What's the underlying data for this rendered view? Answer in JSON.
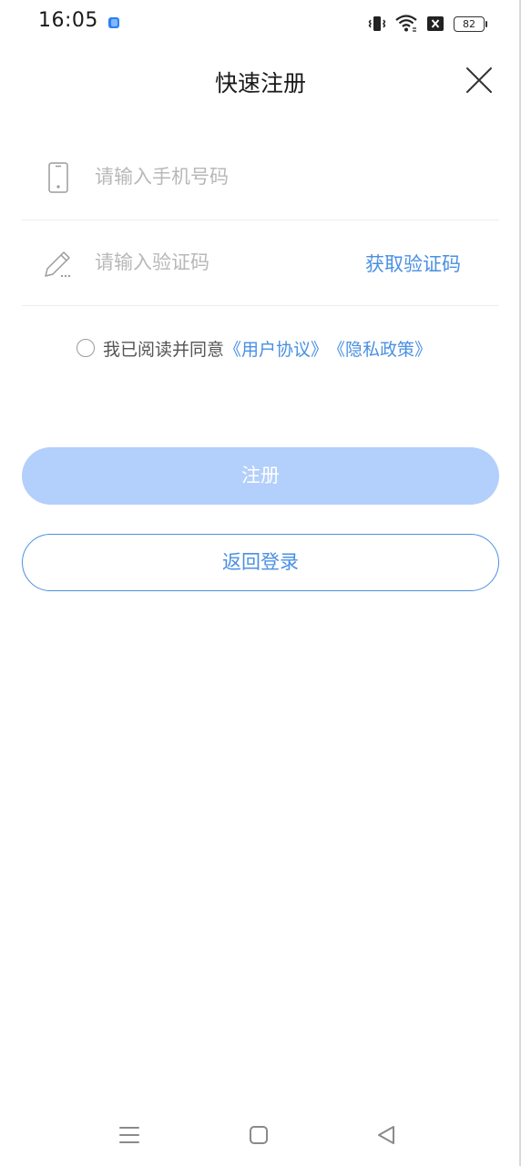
{
  "status_bar": {
    "time": "16:05",
    "battery": "82",
    "icons": [
      "app-notification-icon",
      "vibrate-icon",
      "wifi-icon",
      "no-sim-icon",
      "battery-icon"
    ]
  },
  "header": {
    "title": "快速注册",
    "close_icon": "close-icon"
  },
  "form": {
    "phone": {
      "icon": "phone-icon",
      "placeholder": "请输入手机号码",
      "value": ""
    },
    "code": {
      "icon": "pencil-icon",
      "placeholder": "请输入验证码",
      "value": "",
      "get_code_label": "获取验证码"
    }
  },
  "agreement": {
    "checked": false,
    "text": "我已阅读并同意",
    "user_agreement": "《用户协议》",
    "privacy_policy": "《隐私政策》"
  },
  "buttons": {
    "register": "注册",
    "back_to_login": "返回登录"
  },
  "nav_bar": {
    "items": [
      "menu-icon",
      "home-icon",
      "back-icon"
    ]
  },
  "colors": {
    "accent": "#4a90e2",
    "register_disabled": "#b3cffb",
    "placeholder": "#b8b8b8"
  }
}
